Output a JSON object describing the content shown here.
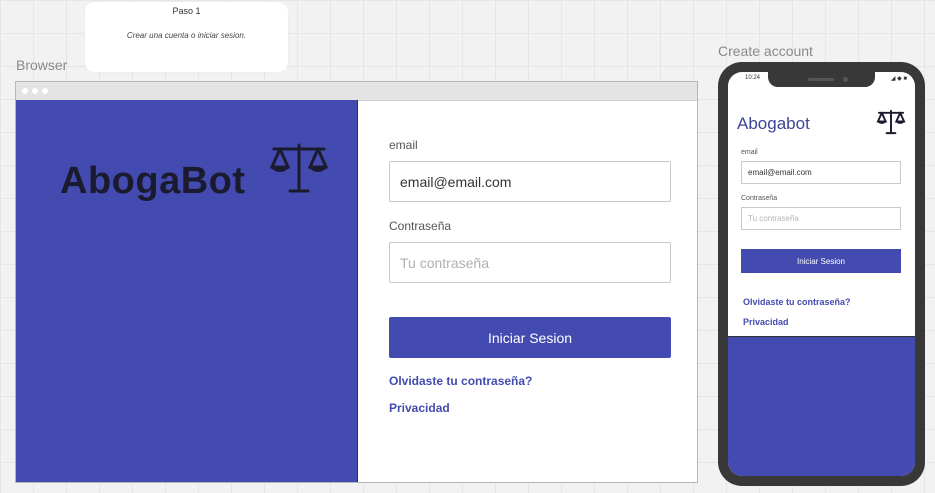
{
  "sticky": {
    "title": "Paso 1",
    "text": "Crear una cuenta o iniciar sesion."
  },
  "frames": {
    "browser_label": "Browser",
    "phone_label": "Create account"
  },
  "brand": {
    "name": "AbogaBot",
    "phone_name": "Abogabot",
    "accent": "#434bb0"
  },
  "login": {
    "email_label": "email",
    "email_value": "email@email.com",
    "password_label": "Contraseña",
    "password_placeholder": "Tu contraseña",
    "submit_label": "Iniciar Sesion",
    "forgot_link": "Olvidaste tu contraseña?",
    "privacy_link": "Privacidad"
  },
  "phone": {
    "time": "10:24",
    "status": "◢ ◆ ■",
    "email_label": "email",
    "email_value": "email@email.com",
    "password_label": "Contraseña",
    "password_placeholder": "Tu contraseña",
    "submit_label": "Iniciar Sesion",
    "forgot_link": "Olvidaste tu contraseña?",
    "privacy_link": "Privacidad"
  }
}
